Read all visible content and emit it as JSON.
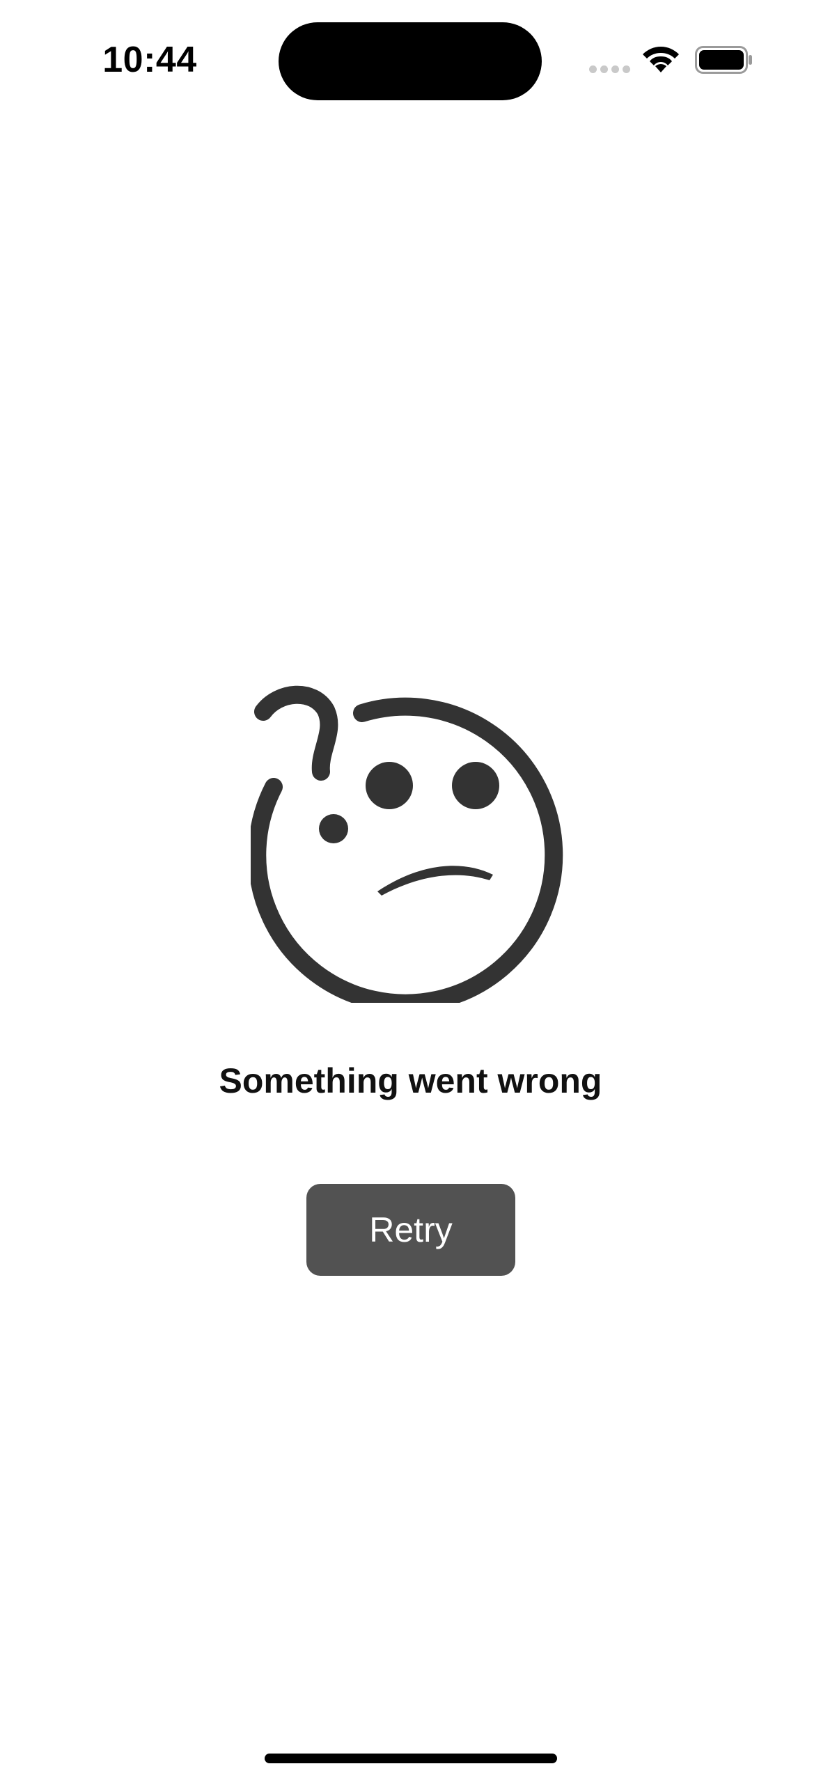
{
  "status_bar": {
    "time": "10:44",
    "icons": [
      "cellular-signal-icon",
      "wifi-icon",
      "battery-icon"
    ]
  },
  "error": {
    "illustration_icon": "confused-sad-face-icon",
    "title": "Something went wrong",
    "retry_label": "Retry"
  },
  "colors": {
    "background": "#ffffff",
    "icon": "#333333",
    "button_background": "#525252",
    "button_text": "#ffffff",
    "title_text": "#111111"
  }
}
